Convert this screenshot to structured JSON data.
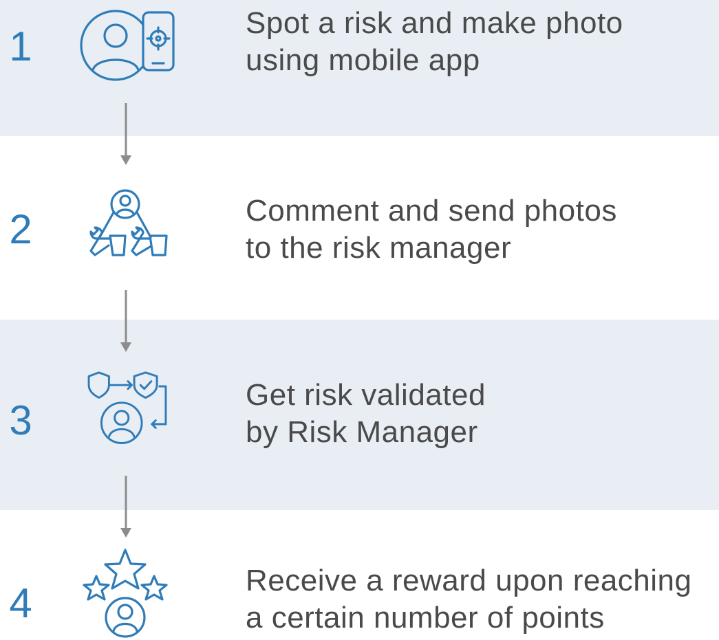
{
  "steps": [
    {
      "number": "1",
      "line1": "Spot a risk and make photo",
      "line2": "using mobile app",
      "icon": "user-phone-target-icon"
    },
    {
      "number": "2",
      "line1": "Comment and send photos",
      "line2": "to the risk manager",
      "icon": "user-tools-icon"
    },
    {
      "number": "3",
      "line1": "Get risk validated",
      "line2": "by Risk Manager",
      "icon": "shield-check-user-icon"
    },
    {
      "number": "4",
      "line1": "Receive a reward upon reaching",
      "line2": "a certain number of points",
      "icon": "user-stars-icon"
    }
  ],
  "colors": {
    "accent": "#2f7cb8",
    "band": "#e9eef5",
    "text": "#4a4a4a",
    "arrow": "#8c8c8c"
  }
}
